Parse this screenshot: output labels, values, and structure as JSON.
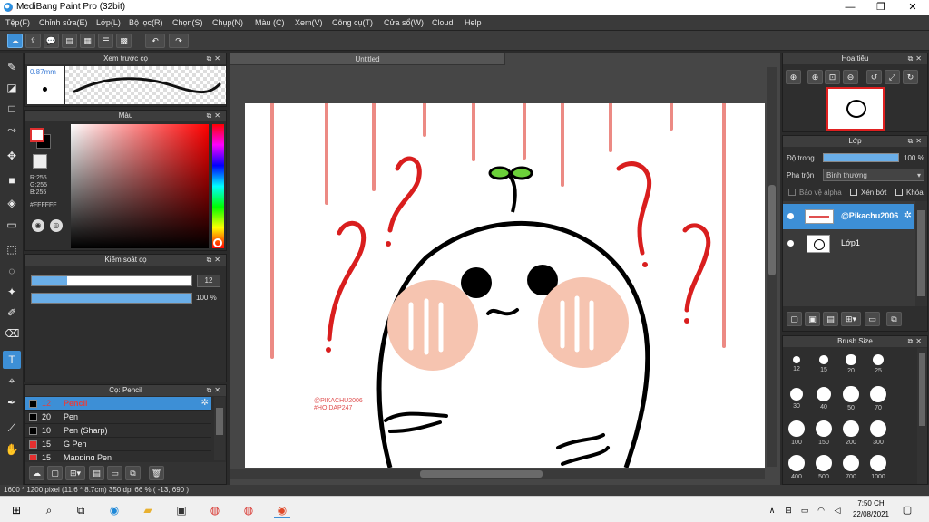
{
  "title_bar": {
    "title": "MediBang Paint Pro (32bit)",
    "min": "—",
    "max": "❐",
    "close": "✕"
  },
  "menu": [
    "Tệp(F)",
    "Chỉnh sửa(E)",
    "Lớp(L)",
    "Bộ lọc(R)",
    "Chọn(S)",
    "Chụp(N)",
    "Màu (C)",
    "Xem(V)",
    "Công cụ(T)",
    "Cửa sổ(W)",
    "Cloud",
    "Help"
  ],
  "toolbar_icons": [
    "cloud-icon",
    "share-icon",
    "comment-icon",
    "message-icon",
    "page-icon",
    "list-icon",
    "grid-icon",
    "undo-icon",
    "redo-icon"
  ],
  "tools": [
    "brush-icon",
    "eraser-icon",
    "rectangle-icon",
    "pen-curve-icon",
    "move-icon",
    "fill-rect-icon",
    "bucket-icon",
    "gradient-icon",
    "select-rect-icon",
    "lasso-icon",
    "magic-wand-icon",
    "select-pen-icon",
    "select-eraser-icon",
    "text-icon",
    "divide-icon",
    "eyedropper-icon",
    "hand-icon"
  ],
  "brush_preview": {
    "title": "Xem trước cọ",
    "size": "0.87mm"
  },
  "color_panel": {
    "title": "Màu",
    "r": "R:255",
    "g": "G:255",
    "b": "B:255",
    "hex": "#FFFFFF",
    "fg": "#ffffff",
    "bg": "#000000"
  },
  "brush_control": {
    "title": "Kiểm soát cọ",
    "size_value": "12",
    "opacity_value": "100 %",
    "size_fraction": 0.22,
    "opacity_fraction": 1.0
  },
  "brush_list": {
    "title": "Cọ: Pencil",
    "items": [
      {
        "size": "12",
        "name": "Pencil",
        "color": "#000000",
        "selected": true
      },
      {
        "size": "20",
        "name": "Pen",
        "color": "#000000",
        "selected": false
      },
      {
        "size": "10",
        "name": "Pen (Sharp)",
        "color": "#000000",
        "selected": false
      },
      {
        "size": "15",
        "name": "G Pen",
        "color": "#e53030",
        "selected": false
      },
      {
        "size": "15",
        "name": "Mapping Pen",
        "color": "#e53030",
        "selected": false
      }
    ]
  },
  "document": {
    "tab": "Untitled",
    "watermark1": "@PIKACHU2006",
    "watermark2": "#HOIDAP247"
  },
  "navigator": {
    "title": "Hoa tiêu"
  },
  "layer_panel": {
    "title": "Lớp",
    "opacity_label": "Độ trong",
    "opacity_value": "100 %",
    "blend_label": "Pha trộn",
    "blend_value": "Bình thường",
    "protect_alpha": "Bảo vệ alpha",
    "clipping": "Xén bớt",
    "lock": "Khóa",
    "layers": [
      {
        "name": "@Pikachu2006",
        "selected": true
      },
      {
        "name": "Lớp1",
        "selected": false
      }
    ]
  },
  "brush_size": {
    "title": "Brush Size",
    "sizes": [
      "12",
      "15",
      "20",
      "25",
      "30",
      "40",
      "50",
      "70",
      "100",
      "150",
      "200",
      "300",
      "400",
      "500",
      "700",
      "1000"
    ]
  },
  "status": {
    "text": "1600 * 1200 pixel   (11.6 * 8.7cm)   350 dpi   66 %   ( -13, 690 )"
  },
  "taskbar": {
    "time": "7:50 CH",
    "date": "22/08/2021"
  }
}
